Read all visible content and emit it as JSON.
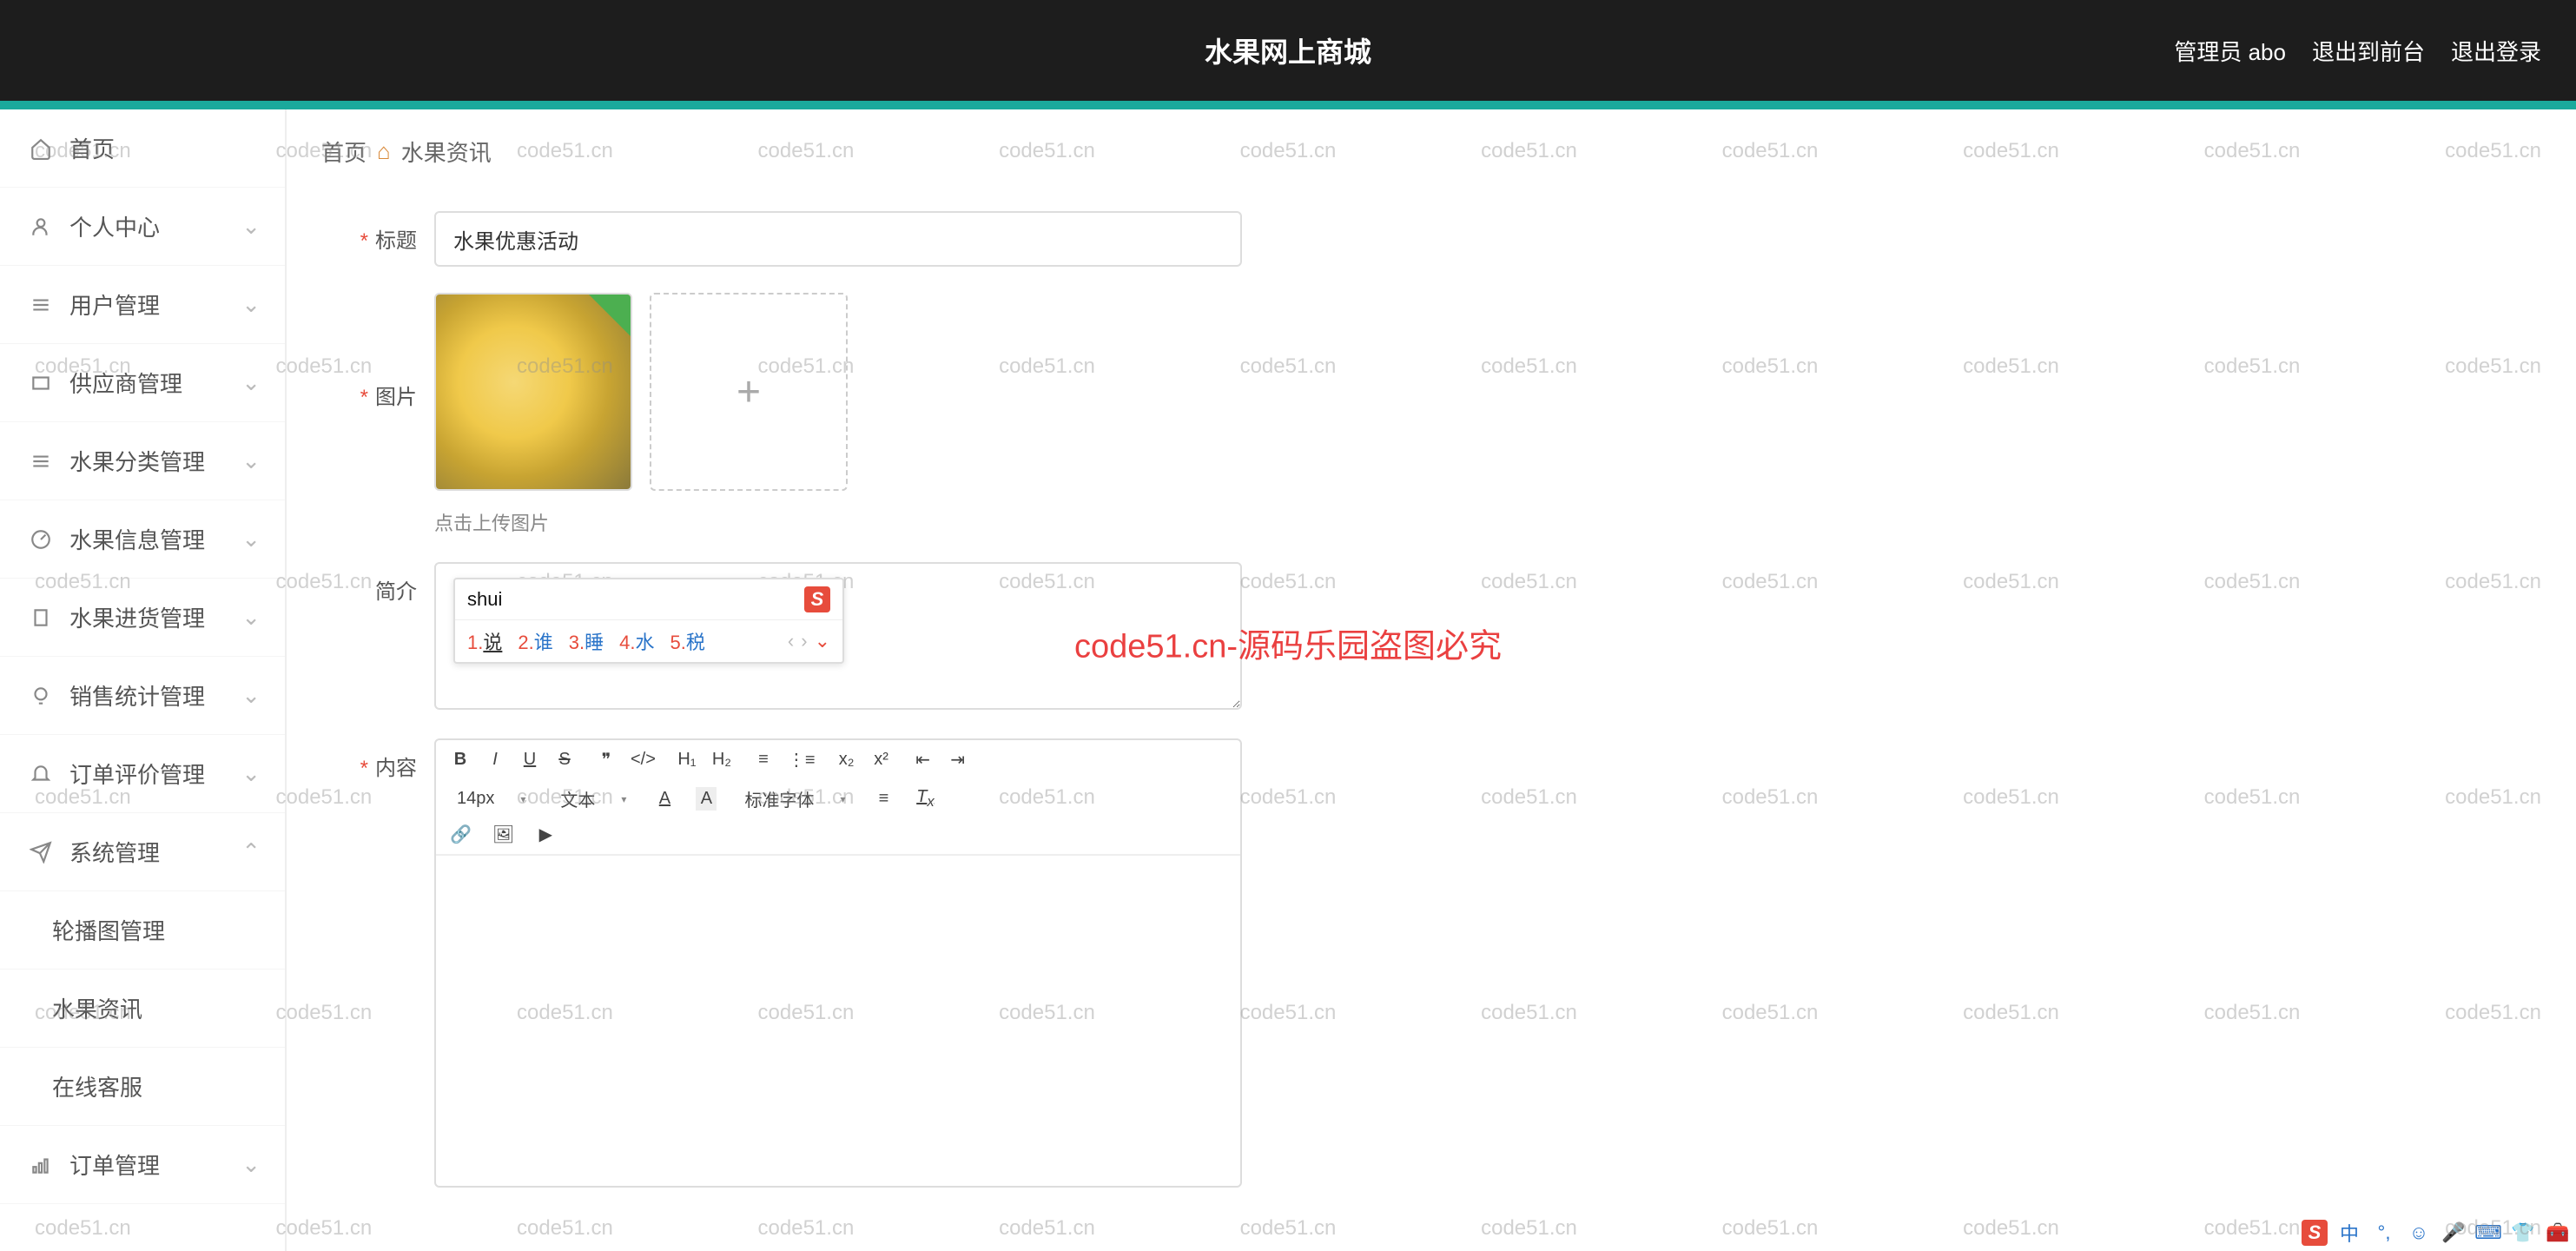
{
  "header": {
    "title": "水果网上商城",
    "admin_label": "管理员 abo",
    "exit_front": "退出到前台",
    "logout": "退出登录"
  },
  "sidebar": {
    "items": [
      {
        "icon": "home",
        "label": "首页",
        "expandable": false
      },
      {
        "icon": "user",
        "label": "个人中心",
        "expandable": true
      },
      {
        "icon": "list",
        "label": "用户管理",
        "expandable": true
      },
      {
        "icon": "box",
        "label": "供应商管理",
        "expandable": true
      },
      {
        "icon": "list",
        "label": "水果分类管理",
        "expandable": true
      },
      {
        "icon": "gauge",
        "label": "水果信息管理",
        "expandable": true
      },
      {
        "icon": "clipboard",
        "label": "水果进货管理",
        "expandable": true
      },
      {
        "icon": "bulb",
        "label": "销售统计管理",
        "expandable": true
      },
      {
        "icon": "bell",
        "label": "订单评价管理",
        "expandable": true
      },
      {
        "icon": "send",
        "label": "系统管理",
        "expandable": true,
        "open": true
      },
      {
        "icon": "",
        "label": "轮播图管理",
        "sub": true
      },
      {
        "icon": "",
        "label": "水果资讯",
        "sub": true
      },
      {
        "icon": "",
        "label": "在线客服",
        "sub": true
      },
      {
        "icon": "bars",
        "label": "订单管理",
        "expandable": true
      }
    ]
  },
  "breadcrumb": {
    "home": "首页",
    "current": "水果资讯"
  },
  "form": {
    "title_label": "标题",
    "title_value": "水果优惠活动",
    "image_label": "图片",
    "image_hint": "点击上传图片",
    "intro_label": "简介",
    "intro_value": "shui",
    "content_label": "内容"
  },
  "ime": {
    "typed": "shui",
    "candidates": [
      {
        "n": "1.",
        "w": "说"
      },
      {
        "n": "2.",
        "w": "谁"
      },
      {
        "n": "3.",
        "w": "睡"
      },
      {
        "n": "4.",
        "w": "水"
      },
      {
        "n": "5.",
        "w": "税"
      }
    ]
  },
  "editor_toolbar": {
    "font_size": "14px",
    "text_type": "文本",
    "font_family": "标准字体"
  },
  "watermark": {
    "text": "code51.cn",
    "center": "code51.cn-源码乐园盗图必究"
  },
  "tray": {
    "ch": "中"
  }
}
